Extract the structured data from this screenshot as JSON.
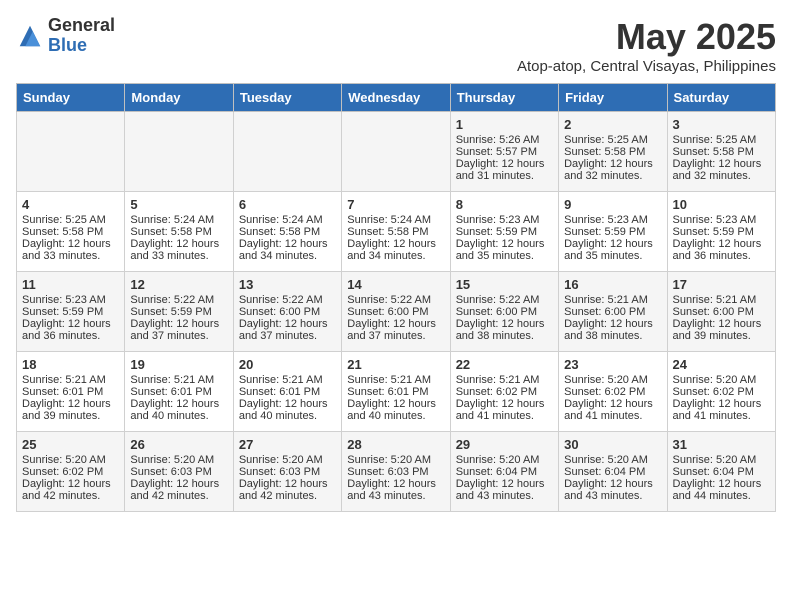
{
  "logo": {
    "general": "General",
    "blue": "Blue"
  },
  "title": "May 2025",
  "subtitle": "Atop-atop, Central Visayas, Philippines",
  "days_of_week": [
    "Sunday",
    "Monday",
    "Tuesday",
    "Wednesday",
    "Thursday",
    "Friday",
    "Saturday"
  ],
  "weeks": [
    [
      {
        "day": "",
        "info": ""
      },
      {
        "day": "",
        "info": ""
      },
      {
        "day": "",
        "info": ""
      },
      {
        "day": "",
        "info": ""
      },
      {
        "day": "1",
        "sunrise": "Sunrise: 5:26 AM",
        "sunset": "Sunset: 5:57 PM",
        "daylight": "Daylight: 12 hours and 31 minutes."
      },
      {
        "day": "2",
        "sunrise": "Sunrise: 5:25 AM",
        "sunset": "Sunset: 5:58 PM",
        "daylight": "Daylight: 12 hours and 32 minutes."
      },
      {
        "day": "3",
        "sunrise": "Sunrise: 5:25 AM",
        "sunset": "Sunset: 5:58 PM",
        "daylight": "Daylight: 12 hours and 32 minutes."
      }
    ],
    [
      {
        "day": "4",
        "sunrise": "Sunrise: 5:25 AM",
        "sunset": "Sunset: 5:58 PM",
        "daylight": "Daylight: 12 hours and 33 minutes."
      },
      {
        "day": "5",
        "sunrise": "Sunrise: 5:24 AM",
        "sunset": "Sunset: 5:58 PM",
        "daylight": "Daylight: 12 hours and 33 minutes."
      },
      {
        "day": "6",
        "sunrise": "Sunrise: 5:24 AM",
        "sunset": "Sunset: 5:58 PM",
        "daylight": "Daylight: 12 hours and 34 minutes."
      },
      {
        "day": "7",
        "sunrise": "Sunrise: 5:24 AM",
        "sunset": "Sunset: 5:58 PM",
        "daylight": "Daylight: 12 hours and 34 minutes."
      },
      {
        "day": "8",
        "sunrise": "Sunrise: 5:23 AM",
        "sunset": "Sunset: 5:59 PM",
        "daylight": "Daylight: 12 hours and 35 minutes."
      },
      {
        "day": "9",
        "sunrise": "Sunrise: 5:23 AM",
        "sunset": "Sunset: 5:59 PM",
        "daylight": "Daylight: 12 hours and 35 minutes."
      },
      {
        "day": "10",
        "sunrise": "Sunrise: 5:23 AM",
        "sunset": "Sunset: 5:59 PM",
        "daylight": "Daylight: 12 hours and 36 minutes."
      }
    ],
    [
      {
        "day": "11",
        "sunrise": "Sunrise: 5:23 AM",
        "sunset": "Sunset: 5:59 PM",
        "daylight": "Daylight: 12 hours and 36 minutes."
      },
      {
        "day": "12",
        "sunrise": "Sunrise: 5:22 AM",
        "sunset": "Sunset: 5:59 PM",
        "daylight": "Daylight: 12 hours and 37 minutes."
      },
      {
        "day": "13",
        "sunrise": "Sunrise: 5:22 AM",
        "sunset": "Sunset: 6:00 PM",
        "daylight": "Daylight: 12 hours and 37 minutes."
      },
      {
        "day": "14",
        "sunrise": "Sunrise: 5:22 AM",
        "sunset": "Sunset: 6:00 PM",
        "daylight": "Daylight: 12 hours and 37 minutes."
      },
      {
        "day": "15",
        "sunrise": "Sunrise: 5:22 AM",
        "sunset": "Sunset: 6:00 PM",
        "daylight": "Daylight: 12 hours and 38 minutes."
      },
      {
        "day": "16",
        "sunrise": "Sunrise: 5:21 AM",
        "sunset": "Sunset: 6:00 PM",
        "daylight": "Daylight: 12 hours and 38 minutes."
      },
      {
        "day": "17",
        "sunrise": "Sunrise: 5:21 AM",
        "sunset": "Sunset: 6:00 PM",
        "daylight": "Daylight: 12 hours and 39 minutes."
      }
    ],
    [
      {
        "day": "18",
        "sunrise": "Sunrise: 5:21 AM",
        "sunset": "Sunset: 6:01 PM",
        "daylight": "Daylight: 12 hours and 39 minutes."
      },
      {
        "day": "19",
        "sunrise": "Sunrise: 5:21 AM",
        "sunset": "Sunset: 6:01 PM",
        "daylight": "Daylight: 12 hours and 40 minutes."
      },
      {
        "day": "20",
        "sunrise": "Sunrise: 5:21 AM",
        "sunset": "Sunset: 6:01 PM",
        "daylight": "Daylight: 12 hours and 40 minutes."
      },
      {
        "day": "21",
        "sunrise": "Sunrise: 5:21 AM",
        "sunset": "Sunset: 6:01 PM",
        "daylight": "Daylight: 12 hours and 40 minutes."
      },
      {
        "day": "22",
        "sunrise": "Sunrise: 5:21 AM",
        "sunset": "Sunset: 6:02 PM",
        "daylight": "Daylight: 12 hours and 41 minutes."
      },
      {
        "day": "23",
        "sunrise": "Sunrise: 5:20 AM",
        "sunset": "Sunset: 6:02 PM",
        "daylight": "Daylight: 12 hours and 41 minutes."
      },
      {
        "day": "24",
        "sunrise": "Sunrise: 5:20 AM",
        "sunset": "Sunset: 6:02 PM",
        "daylight": "Daylight: 12 hours and 41 minutes."
      }
    ],
    [
      {
        "day": "25",
        "sunrise": "Sunrise: 5:20 AM",
        "sunset": "Sunset: 6:02 PM",
        "daylight": "Daylight: 12 hours and 42 minutes."
      },
      {
        "day": "26",
        "sunrise": "Sunrise: 5:20 AM",
        "sunset": "Sunset: 6:03 PM",
        "daylight": "Daylight: 12 hours and 42 minutes."
      },
      {
        "day": "27",
        "sunrise": "Sunrise: 5:20 AM",
        "sunset": "Sunset: 6:03 PM",
        "daylight": "Daylight: 12 hours and 42 minutes."
      },
      {
        "day": "28",
        "sunrise": "Sunrise: 5:20 AM",
        "sunset": "Sunset: 6:03 PM",
        "daylight": "Daylight: 12 hours and 43 minutes."
      },
      {
        "day": "29",
        "sunrise": "Sunrise: 5:20 AM",
        "sunset": "Sunset: 6:04 PM",
        "daylight": "Daylight: 12 hours and 43 minutes."
      },
      {
        "day": "30",
        "sunrise": "Sunrise: 5:20 AM",
        "sunset": "Sunset: 6:04 PM",
        "daylight": "Daylight: 12 hours and 43 minutes."
      },
      {
        "day": "31",
        "sunrise": "Sunrise: 5:20 AM",
        "sunset": "Sunset: 6:04 PM",
        "daylight": "Daylight: 12 hours and 44 minutes."
      }
    ]
  ]
}
